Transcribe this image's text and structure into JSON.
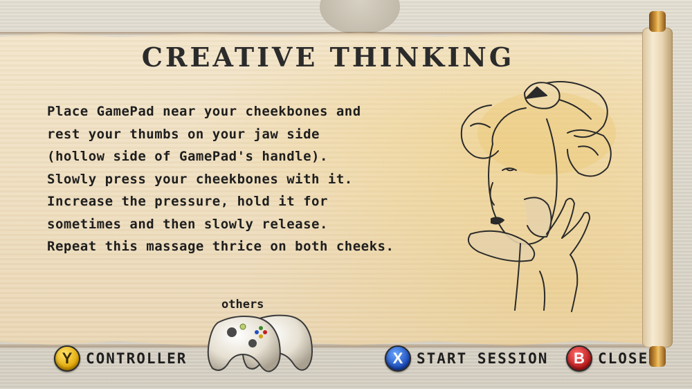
{
  "screen": {
    "title": "CREATIVE THINKING",
    "instructions": [
      "Place GamePad near your cheekbones and",
      "rest your thumbs on your jaw side",
      "(hollow side of GamePad's handle).",
      "Slowly press your cheekbones with it.",
      "Increase the pressure, hold it for",
      "sometimes and then slowly release.",
      "Repeat this massage thrice on both cheeks."
    ]
  },
  "controller_select": {
    "label": "others",
    "icon": "controller-icon"
  },
  "prompts": {
    "controller": {
      "button": "Y",
      "label": "CONTROLLER",
      "color": "#f0c020"
    },
    "start_session": {
      "button": "X",
      "label": "START SESSION",
      "color": "#2a5fd0"
    },
    "close": {
      "button": "B",
      "label": "CLOSE",
      "color": "#c82020"
    }
  },
  "colors": {
    "scroll_paper": "#efdfc1",
    "roller_gold": "#d39a3a",
    "ink": "#1e1e1e"
  },
  "illustration": {
    "icon": "geisha-portrait-illustration"
  }
}
